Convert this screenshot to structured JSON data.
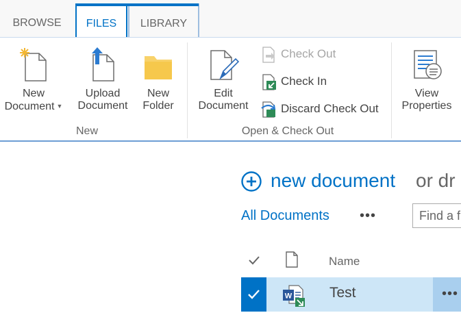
{
  "tabs": {
    "browse": "BROWSE",
    "files": "FILES",
    "library": "LIBRARY"
  },
  "ribbon": {
    "new_group": {
      "label": "New",
      "new_document": {
        "line1": "New",
        "line2": "Document",
        "icon": "new-document-icon"
      },
      "upload_document": {
        "line1": "Upload",
        "line2": "Document",
        "icon": "upload-icon"
      },
      "new_folder": {
        "line1": "New",
        "line2": "Folder",
        "icon": "folder-icon"
      }
    },
    "open_group": {
      "label": "Open & Check Out",
      "edit_document": {
        "line1": "Edit",
        "line2": "Document",
        "icon": "edit-document-icon"
      },
      "check_out": "Check Out",
      "check_in": "Check In",
      "discard_check_out": "Discard Check Out"
    },
    "view_properties": {
      "line1": "View",
      "line2": "Properties",
      "icon": "view-properties-icon"
    }
  },
  "content": {
    "new_document_link": "new document",
    "new_document_rest": "or dr",
    "view_name": "All Documents",
    "view_more": "•••",
    "find_placeholder": "Find a f",
    "columns": {
      "name": "Name"
    },
    "rows": [
      {
        "name": "Test",
        "type": "word-document-checked-out",
        "selected": true
      }
    ],
    "row_more": "•••"
  },
  "colors": {
    "accent": "#0072c6",
    "selected_row": "#cde6f7",
    "folder": "#f8d26a"
  }
}
